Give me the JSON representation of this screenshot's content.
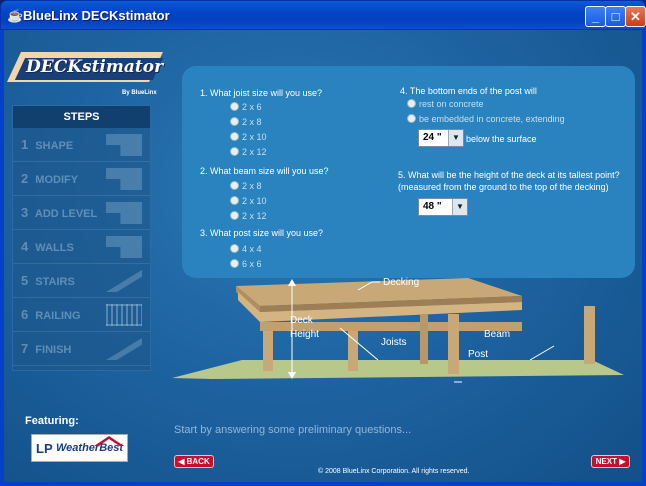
{
  "window": {
    "title": "BlueLinx DECKstimator",
    "controls": {
      "minimize": "_",
      "maximize": "□",
      "close": "✕"
    }
  },
  "logo": {
    "wordmark": "DECKstimator",
    "byline": "By BlueLinx"
  },
  "steps": {
    "header": "STEPS",
    "items": [
      {
        "num": "1",
        "label": "SHAPE",
        "icon": "shape-thumbnail-icon"
      },
      {
        "num": "2",
        "label": "MODIFY",
        "icon": "modify-thumbnail-icon"
      },
      {
        "num": "3",
        "label": "ADD LEVEL",
        "icon": "add-level-thumbnail-icon"
      },
      {
        "num": "4",
        "label": "WALLS",
        "icon": "walls-thumbnail-icon"
      },
      {
        "num": "5",
        "label": "STAIRS",
        "icon": "stairs-thumbnail-icon"
      },
      {
        "num": "6",
        "label": "RAILING",
        "icon": "railing-thumbnail-icon"
      },
      {
        "num": "7",
        "label": "FINISH",
        "icon": "finish-thumbnail-icon"
      }
    ]
  },
  "featuring": {
    "label": "Featuring:",
    "sponsor": {
      "lp": "LP",
      "name": "WeatherBest"
    }
  },
  "questions": {
    "q1": {
      "text": "1. What joist size will you use?",
      "options": [
        "2 x 6",
        "2 x 8",
        "2 x 10",
        "2 x 12"
      ]
    },
    "q2": {
      "text": "2. What beam size will you use?",
      "options": [
        "2 x 8",
        "2 x 10",
        "2 x 12"
      ]
    },
    "q3": {
      "text": "3. What post size will you use?",
      "options": [
        "4 x 4",
        "6 x 6"
      ]
    },
    "q4": {
      "text": "4. The bottom ends of the post will",
      "options": [
        "rest on concrete",
        "be embedded in concrete, extending"
      ],
      "depth_value": "24 \"",
      "depth_suffix": "below the surface"
    },
    "q5": {
      "text": "5. What will be the height of the deck at its tallest point?",
      "subtext": "(measured from the ground to the top of the decking)",
      "height_value": "48 \""
    }
  },
  "diagram": {
    "labels": {
      "decking": "Decking",
      "deck_height": "Deck Height",
      "joists": "Joists",
      "beam": "Beam",
      "post": "Post"
    },
    "colors": {
      "wood": "#c9a877",
      "wood_dark": "#9e7e52",
      "ground": "#b8c88a"
    }
  },
  "hint": "Start by answering some preliminary questions...",
  "nav": {
    "back": "◀ BACK",
    "next": "NEXT ▶"
  },
  "copyright": "© 2008 BlueLinx Corporation.  All rights reserved."
}
